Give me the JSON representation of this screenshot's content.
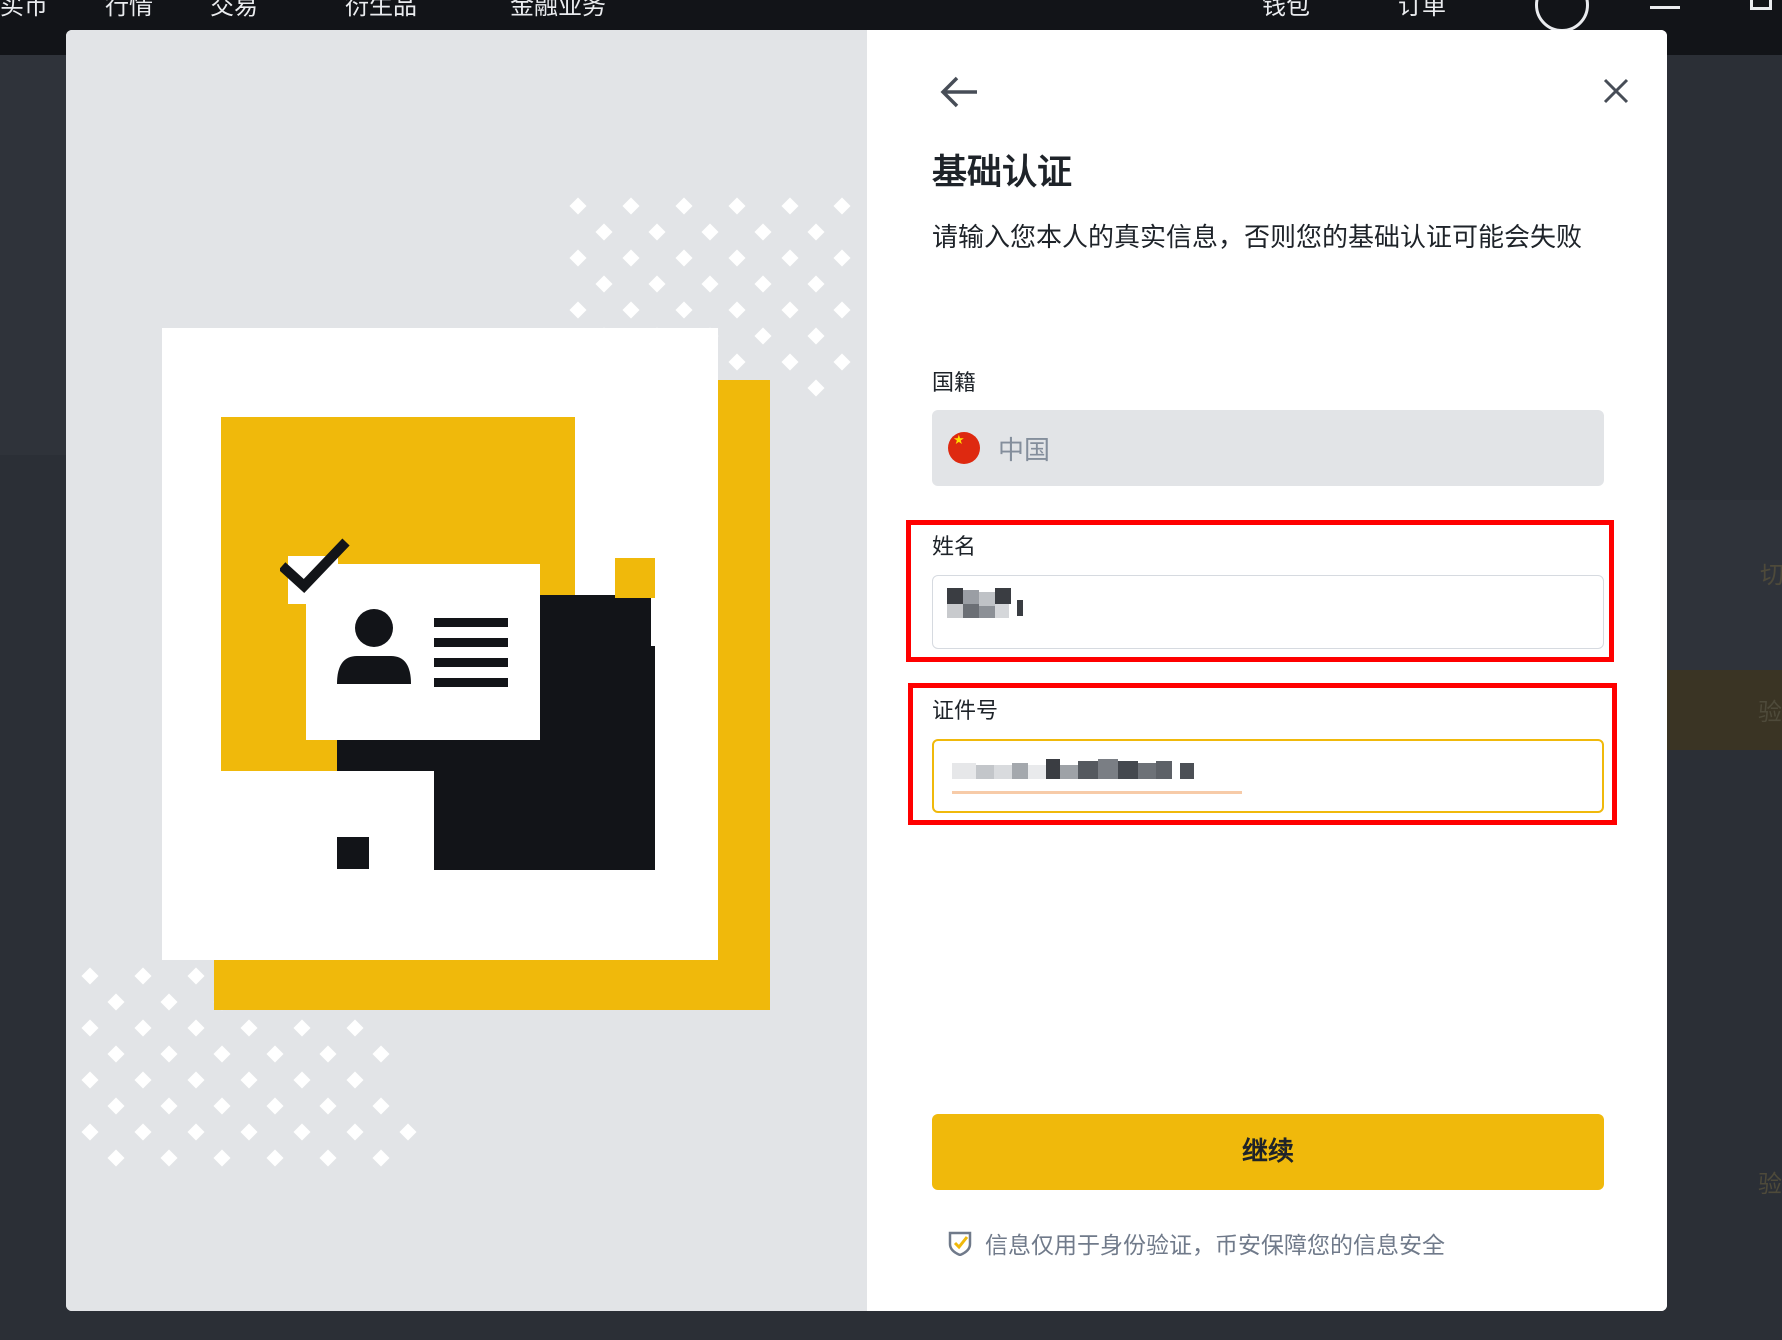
{
  "topbar": {
    "nav_items": [
      "买币",
      "行情",
      "交易",
      "衍生品",
      "金融业务",
      "钱包",
      "订单"
    ],
    "icons": [
      "user-icon",
      "menu-icon",
      "download-icon"
    ]
  },
  "background": {
    "right_texts": [
      "切",
      "验",
      "验"
    ]
  },
  "modal": {
    "title": "基础认证",
    "description": "请输入您本人的真实信息，否则您的基础认证可能会失败",
    "nationality": {
      "label": "国籍",
      "value": "中国",
      "flag_icon": "china-flag-icon"
    },
    "name": {
      "label": "姓名",
      "value": "(blurred)"
    },
    "id_number": {
      "label": "证件号",
      "value": "(blurred)"
    },
    "continue_label": "继续",
    "privacy_note": "信息仅用于身份验证，币安保障您的信息安全",
    "back_icon": "arrow-left-icon",
    "close_icon": "close-icon",
    "shield_icon": "shield-check-icon"
  },
  "colors": {
    "accent": "#f0b90b",
    "dark": "#121418",
    "highlight": "#ff0000",
    "panel": "#e2e4e7"
  }
}
